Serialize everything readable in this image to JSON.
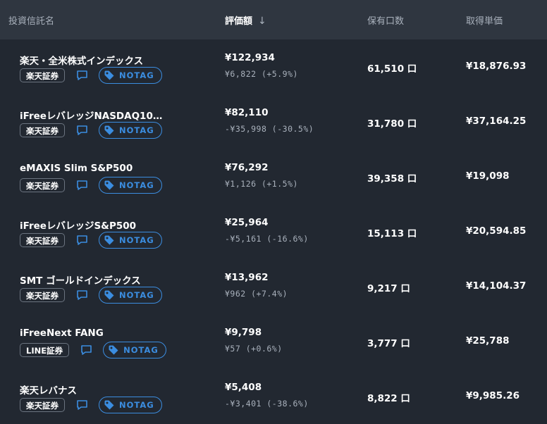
{
  "header": {
    "name": "投資信託名",
    "valuation": "評価額",
    "sort_arrow": "↓",
    "units": "保有口数",
    "unit_price": "取得単価"
  },
  "notag_label": "NOTAG",
  "colors": {
    "accent": "#3b8de0",
    "background": "#222831",
    "header_bg": "#2f3640",
    "muted": "#a9b1bc"
  },
  "funds": [
    {
      "name": "楽天・全米株式インデックス",
      "broker": "楽天証券",
      "value": "¥122,934",
      "change": "¥6,822 (+5.9%)",
      "units": "61,510 口",
      "unit_price": "¥18,876.93"
    },
    {
      "name": "iFreeレバレッジNASDAQ10…",
      "broker": "楽天証券",
      "value": "¥82,110",
      "change": "-¥35,998 (-30.5%)",
      "units": "31,780 口",
      "unit_price": "¥37,164.25"
    },
    {
      "name": "eMAXIS Slim S&P500",
      "broker": "楽天証券",
      "value": "¥76,292",
      "change": "¥1,126 (+1.5%)",
      "units": "39,358 口",
      "unit_price": "¥19,098"
    },
    {
      "name": "iFreeレバレッジS&P500",
      "broker": "楽天証券",
      "value": "¥25,964",
      "change": "-¥5,161 (-16.6%)",
      "units": "15,113 口",
      "unit_price": "¥20,594.85"
    },
    {
      "name": "SMT ゴールドインデックス",
      "broker": "楽天証券",
      "value": "¥13,962",
      "change": "¥962 (+7.4%)",
      "units": "9,217 口",
      "unit_price": "¥14,104.37"
    },
    {
      "name": "iFreeNext FANG",
      "broker": "LINE証券",
      "value": "¥9,798",
      "change": "¥57 (+0.6%)",
      "units": "3,777 口",
      "unit_price": "¥25,788"
    },
    {
      "name": "楽天レバナス",
      "broker": "楽天証券",
      "value": "¥5,408",
      "change": "-¥3,401 (-38.6%)",
      "units": "8,822 口",
      "unit_price": "¥9,985.26"
    }
  ]
}
